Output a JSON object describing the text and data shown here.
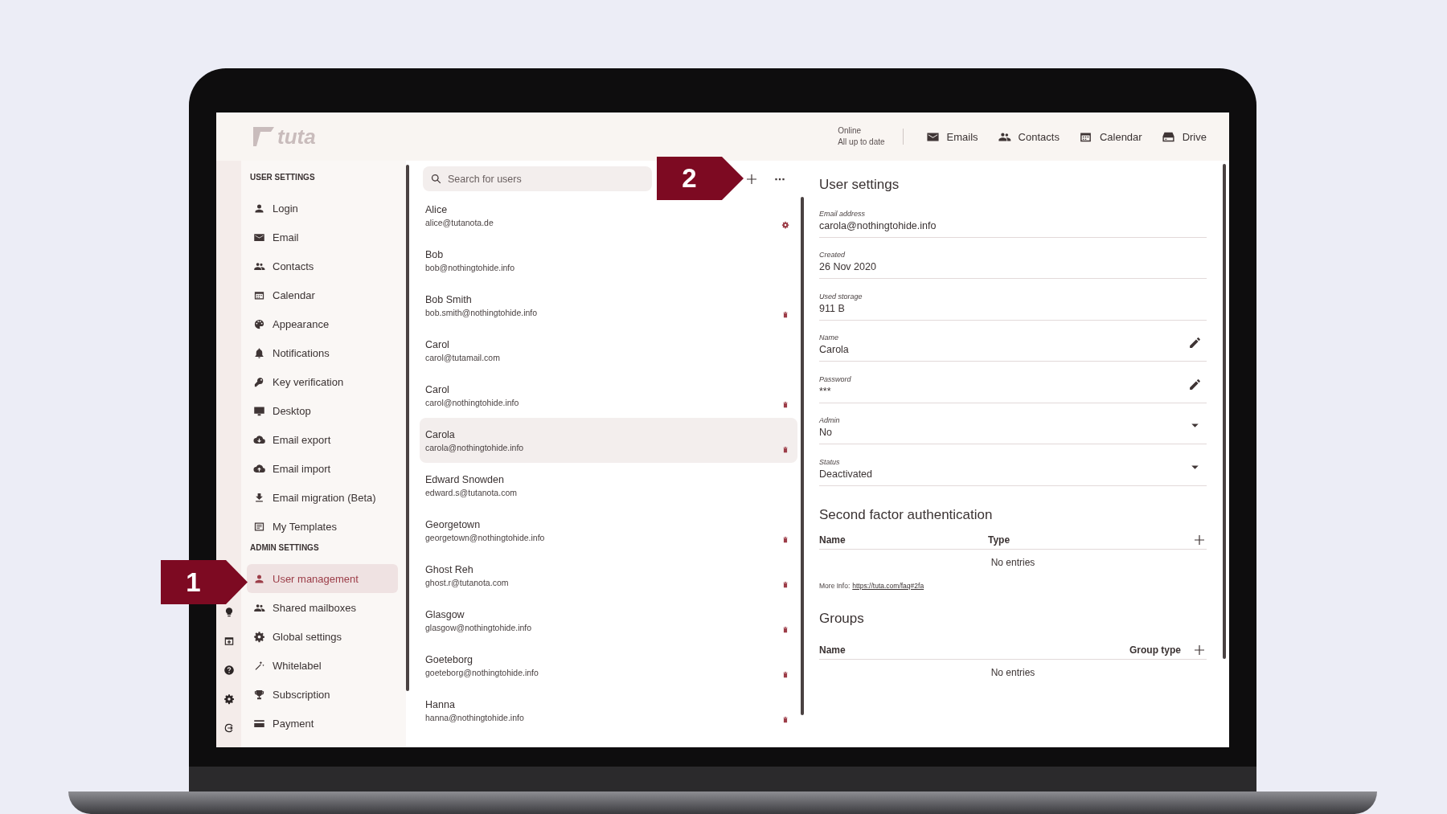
{
  "header": {
    "logo": "tuta",
    "status": [
      "Online",
      "All up to date"
    ],
    "nav": [
      {
        "label": "Emails"
      },
      {
        "label": "Contacts"
      },
      {
        "label": "Calendar"
      },
      {
        "label": "Drive"
      }
    ]
  },
  "sidebar": {
    "sections": [
      {
        "title": "USER SETTINGS",
        "items": [
          {
            "label": "Login",
            "selected": false
          },
          {
            "label": "Email",
            "selected": false
          },
          {
            "label": "Contacts",
            "selected": false
          },
          {
            "label": "Calendar",
            "selected": false
          },
          {
            "label": "Appearance",
            "selected": false
          },
          {
            "label": "Notifications",
            "selected": false
          },
          {
            "label": "Key verification",
            "selected": false
          },
          {
            "label": "Desktop",
            "selected": false
          },
          {
            "label": "Email export",
            "selected": false
          },
          {
            "label": "Email import",
            "selected": false
          },
          {
            "label": "Email migration (Beta)",
            "selected": false
          },
          {
            "label": "My Templates",
            "selected": false
          }
        ]
      },
      {
        "title": "ADMIN SETTINGS",
        "items": [
          {
            "label": "User management",
            "selected": true
          },
          {
            "label": "Shared mailboxes",
            "selected": false
          },
          {
            "label": "Global settings",
            "selected": false
          },
          {
            "label": "Whitelabel",
            "selected": false
          },
          {
            "label": "Subscription",
            "selected": false
          },
          {
            "label": "Payment",
            "selected": false
          }
        ]
      }
    ]
  },
  "users": {
    "search": {
      "placeholder": "Search for users"
    },
    "rows": [
      {
        "name": "Alice",
        "email": "alice@tutanota.de",
        "kind": "admin",
        "selected": false
      },
      {
        "name": "Bob",
        "email": "bob@nothingtohide.info",
        "kind": "plain",
        "selected": false
      },
      {
        "name": "Bob Smith",
        "email": "bob.smith@nothingtohide.info",
        "kind": "deletable",
        "selected": false
      },
      {
        "name": "Carol",
        "email": "carol@tutamail.com",
        "kind": "plain",
        "selected": false
      },
      {
        "name": "Carol",
        "email": "carol@nothingtohide.info",
        "kind": "deletable",
        "selected": false
      },
      {
        "name": "Carola",
        "email": "carola@nothingtohide.info",
        "kind": "deletable",
        "selected": true
      },
      {
        "name": "Edward Snowden",
        "email": "edward.s@tutanota.com",
        "kind": "plain",
        "selected": false
      },
      {
        "name": "Georgetown",
        "email": "georgetown@nothingtohide.info",
        "kind": "deletable",
        "selected": false
      },
      {
        "name": "Ghost Reh",
        "email": "ghost.r@tutanota.com",
        "kind": "deletable",
        "selected": false
      },
      {
        "name": "Glasgow",
        "email": "glasgow@nothingtohide.info",
        "kind": "deletable",
        "selected": false
      },
      {
        "name": "Goeteborg",
        "email": "goeteborg@nothingtohide.info",
        "kind": "deletable",
        "selected": false
      },
      {
        "name": "Hanna",
        "email": "hanna@nothingtohide.info",
        "kind": "deletable",
        "selected": false
      }
    ]
  },
  "detail": {
    "title": "User settings",
    "fields": [
      {
        "label": "Email address",
        "value": "carola@nothingtohide.info",
        "kind": "text"
      },
      {
        "label": "Created",
        "value": "26 Nov 2020",
        "kind": "text"
      },
      {
        "label": "Used storage",
        "value": "911 B",
        "kind": "text"
      },
      {
        "label": "Name",
        "value": "Carola",
        "kind": "edit"
      },
      {
        "label": "Password",
        "value": "***",
        "kind": "edit"
      },
      {
        "label": "Admin",
        "value": "No",
        "kind": "dropdown"
      },
      {
        "label": "Status",
        "value": "Deactivated",
        "kind": "dropdown"
      }
    ],
    "second_factor": {
      "title": "Second factor authentication",
      "columns": [
        "Name",
        "Type"
      ],
      "empty": "No entries",
      "more_info": "More Info:",
      "link": "https://tuta.com/faq#2fa"
    },
    "groups": {
      "title": "Groups",
      "columns": [
        "Name",
        "Group type"
      ],
      "empty": "No entries"
    }
  },
  "callouts": [
    {
      "label": "1"
    },
    {
      "label": "2"
    }
  ]
}
